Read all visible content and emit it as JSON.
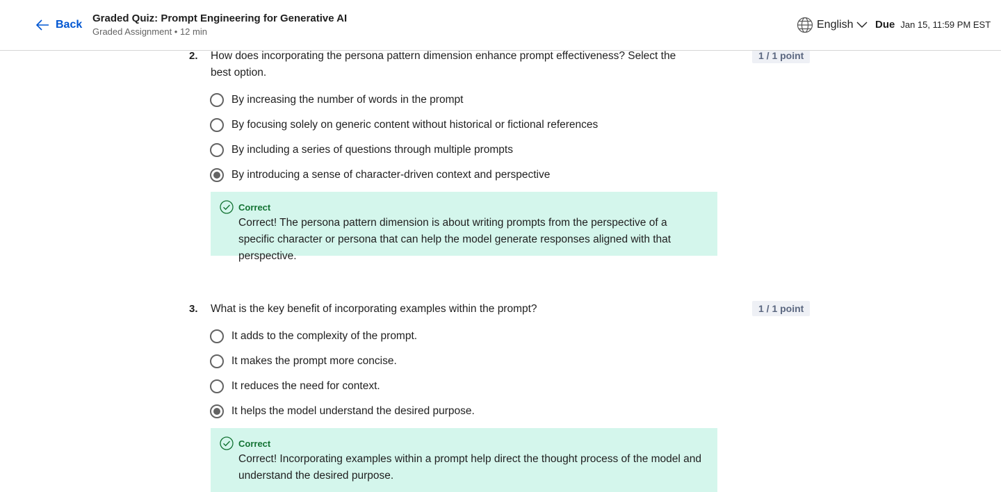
{
  "header": {
    "back_label": "Back",
    "title": "Graded Quiz: Prompt Engineering for Generative AI",
    "subtitle": "Graded Assignment • 12 min",
    "language": "English",
    "due_label": "Due",
    "due_value": "Jan 15, 11:59 PM EST"
  },
  "questions": [
    {
      "number": "2.",
      "text": "How does incorporating the persona pattern dimension enhance prompt effectiveness? Select the best option.",
      "points": "1 / 1 point",
      "options": [
        {
          "label": "By increasing the number of words in the prompt",
          "selected": false
        },
        {
          "label": "By focusing solely on generic content without historical or fictional references",
          "selected": false
        },
        {
          "label": "By including a series of questions through multiple prompts",
          "selected": false
        },
        {
          "label": "By introducing a sense of character-driven context and perspective",
          "selected": true
        }
      ],
      "feedback": {
        "status": "Correct",
        "text": "Correct! The persona pattern dimension is about writing prompts from the perspective of a specific character or persona that can help the model generate responses aligned with that perspective."
      }
    },
    {
      "number": "3.",
      "text": "What is the key benefit of incorporating examples within the prompt?",
      "points": "1 / 1 point",
      "options": [
        {
          "label": "It adds to the complexity of the prompt.",
          "selected": false
        },
        {
          "label": "It makes the prompt more concise.",
          "selected": false
        },
        {
          "label": "It reduces the need for context.",
          "selected": false
        },
        {
          "label": "It helps the model understand the desired purpose.",
          "selected": true
        }
      ],
      "feedback": {
        "status": "Correct",
        "text": "Correct! Incorporating examples within a prompt help direct the thought process of the model and understand the desired purpose."
      }
    }
  ],
  "colors": {
    "link": "#0056d2",
    "correct_bg": "#d4f6ec",
    "correct_text": "#137333",
    "points_bg": "#eef0f5"
  },
  "icons": {
    "back": "arrow-left-icon",
    "language": "globe-icon",
    "dropdown": "chevron-down-icon",
    "correct": "check-circle-icon"
  }
}
